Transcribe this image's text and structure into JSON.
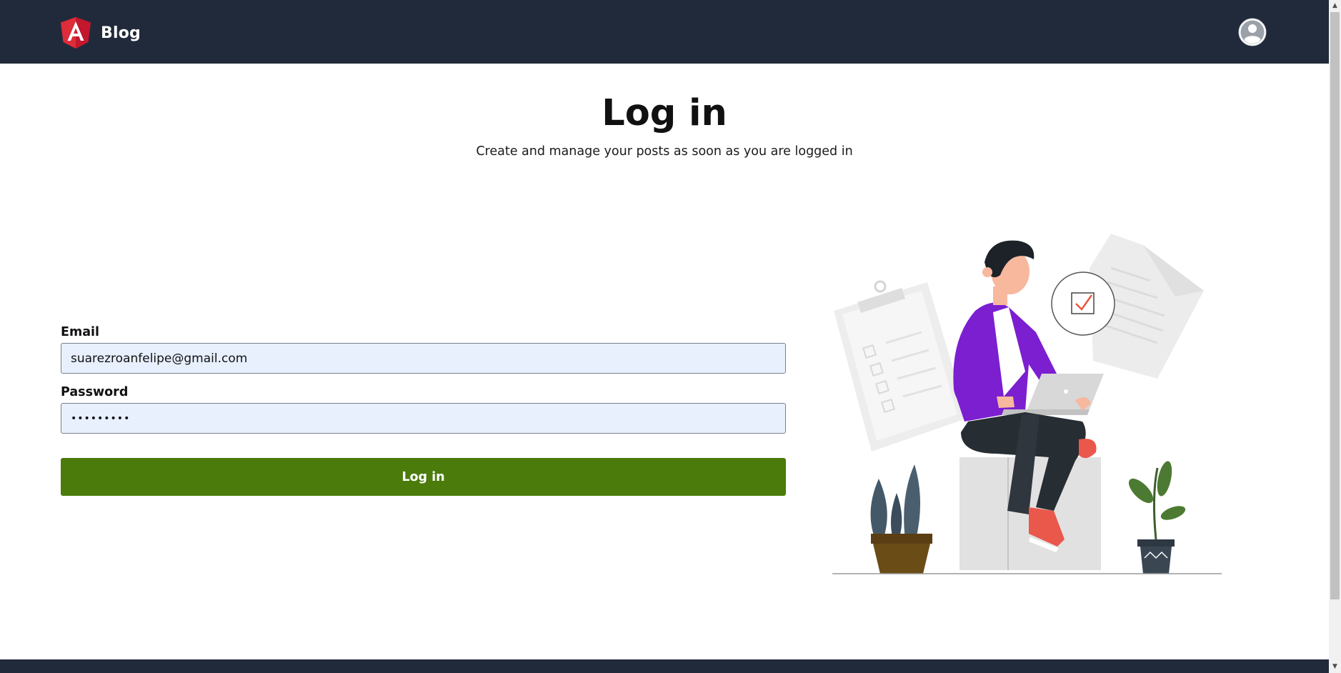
{
  "navbar": {
    "brand_text": "Blog",
    "logo_icon": "angular-logo-icon",
    "user_icon": "user-avatar-icon",
    "background": "#212a3a"
  },
  "page": {
    "title": "Log in",
    "subtitle": "Create and manage your posts as soon as you are logged in"
  },
  "form": {
    "email_label": "Email",
    "email_value": "suarezroanfelipe@gmail.com",
    "password_label": "Password",
    "password_value": "•••••••••",
    "submit_label": "Log in",
    "input_background": "#e8f0fe",
    "submit_color": "#4b7b0b"
  },
  "illustration": {
    "name": "man-with-laptop-illustration",
    "accent": "#7b1fd0"
  }
}
